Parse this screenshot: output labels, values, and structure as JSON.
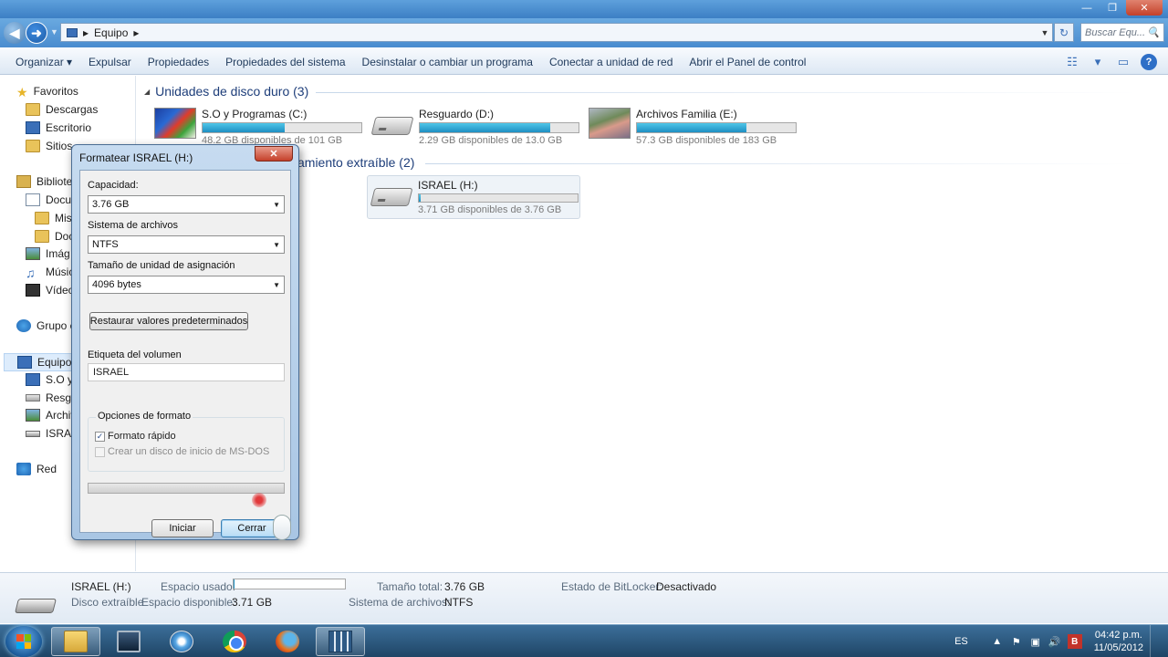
{
  "window": {
    "minimize_glyph": "—",
    "maximize_glyph": "❐",
    "close_glyph": "✕"
  },
  "address": {
    "back_glyph": "◀",
    "forward_glyph": "➜",
    "separator": "▸",
    "path": "Equipo",
    "path_arrow": "▸",
    "dropdown_glyph": "▼",
    "refresh_glyph": "↻",
    "search_placeholder": "Buscar Equ...",
    "search_glyph": "🔍"
  },
  "command_bar": {
    "items": [
      "Organizar ▾",
      "Expulsar",
      "Propiedades",
      "Propiedades del sistema",
      "Desinstalar o cambiar un programa",
      "Conectar a unidad de red",
      "Abrir el Panel de control"
    ],
    "view_glyph": "☷",
    "view_drop": "▾",
    "pane_glyph": "▭",
    "help_glyph": "?"
  },
  "nav_pane": {
    "favorites": "Favoritos",
    "downloads": "Descargas",
    "desktop": "Escritorio",
    "recent": "Sitios",
    "libraries": "Bibliote",
    "documents": "Docur",
    "my_docs": "Mis",
    "public_docs": "Doc",
    "images": "Imág",
    "music": "Músic",
    "videos": "Vídeo",
    "homegroup": "Grupo e",
    "computer": "Equipo",
    "drive_c": "S.O y",
    "drive_d": "Resgu",
    "drive_e": "Archiv",
    "drive_h": "ISRAE",
    "network": "Red",
    "star_glyph": "★",
    "music_glyph": "♫",
    "tri": "▸"
  },
  "content": {
    "hdd_group": {
      "collapse_glyph": "◢",
      "title": "Unidades de disco duro (3)"
    },
    "removable_group": {
      "title_partial": "amiento extraíble (2)"
    },
    "drives": [
      {
        "name": "S.O y Programas (C:)",
        "free": "48.2 GB disponibles de 101 GB",
        "used_fraction": 0.52
      },
      {
        "name": "Resguardo (D:)",
        "free": "2.29 GB disponibles de 13.0 GB",
        "used_fraction": 0.82
      },
      {
        "name": "Archivos Familia (E:)",
        "free": "57.3 GB disponibles de 183 GB",
        "used_fraction": 0.69
      },
      {
        "name": "ISRAEL (H:)",
        "free": "3.71 GB disponibles de 3.76 GB",
        "used_fraction": 0.01
      }
    ]
  },
  "dialog": {
    "title": "Formatear ISRAEL (H:)",
    "close_glyph": "✕",
    "capacity_label": "Capacidad:",
    "capacity_value": "3.76 GB",
    "fs_label": "Sistema de archivos",
    "fs_value": "NTFS",
    "alloc_label": "Tamaño de unidad de asignación",
    "alloc_value": "4096 bytes",
    "arrow_glyph": "▼",
    "restore_button": "Restaurar valores predeterminados",
    "volume_label": "Etiqueta del volumen",
    "volume_value": "ISRAEL",
    "options_legend": "Opciones de formato",
    "quick_format": "Formato rápido",
    "quick_format_checked": true,
    "check_glyph": "✓",
    "msdos": "Crear un disco de inicio de MS-DOS",
    "start_button": "Iniciar",
    "close_button": "Cerrar",
    "progress_fraction": 0
  },
  "details": {
    "name": "ISRAEL (H:)",
    "type": "Disco extraíble",
    "used_label": "Espacio usado:",
    "used_fraction": 0.01,
    "free_label": "Espacio disponible:",
    "free_value": "3.71 GB",
    "total_label": "Tamaño total:",
    "total_value": "3.76 GB",
    "fs_label": "Sistema de archivos:",
    "fs_value": "NTFS",
    "bitlocker_label": "Estado de BitLocker:",
    "bitlocker_value": "Desactivado"
  },
  "taskbar": {
    "language": "ES",
    "tray_up": "▲",
    "tray_flag": "⚑",
    "tray_net": "▣",
    "tray_volume": "🔊",
    "tray_b": "B",
    "time": "04:42 p.m.",
    "date": "11/05/2012"
  }
}
